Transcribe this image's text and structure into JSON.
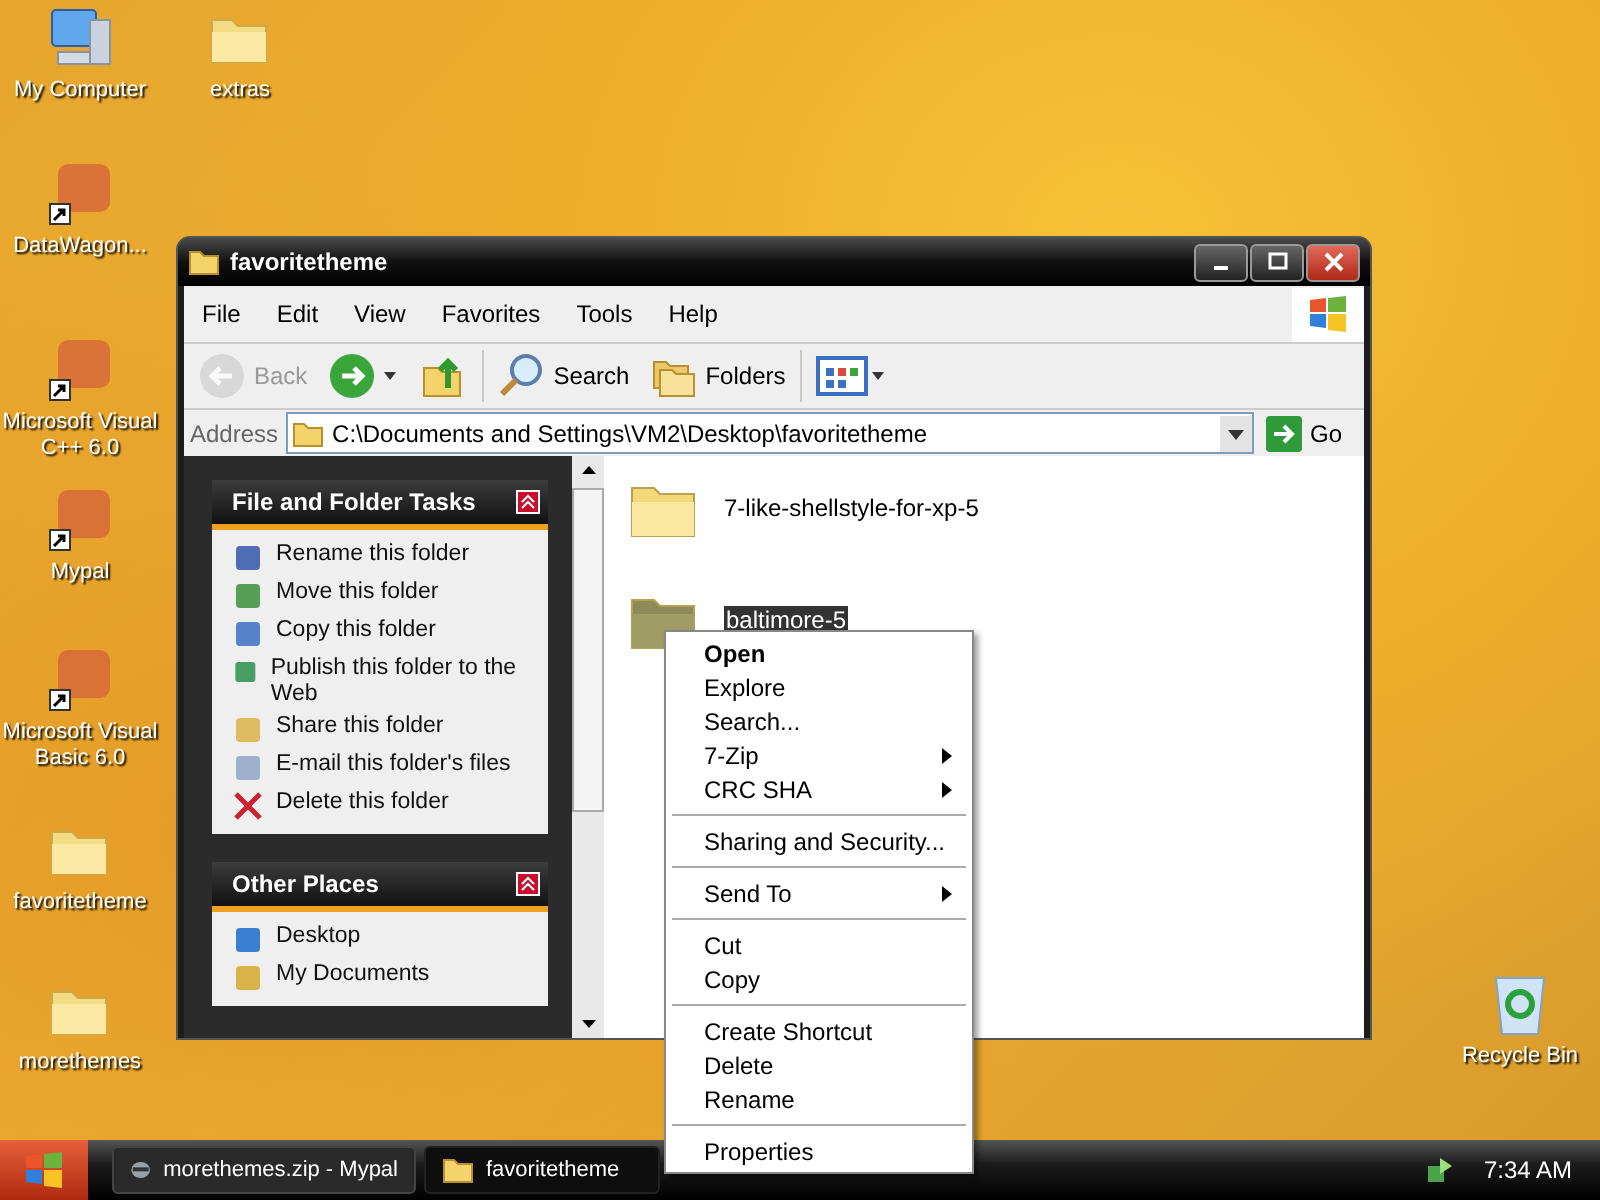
{
  "desktop_icons": [
    {
      "label": "My Computer",
      "kind": "computer"
    },
    {
      "label": "extras",
      "kind": "folder"
    },
    {
      "label": "DataWagon...",
      "kind": "shortcut"
    },
    {
      "label": "Microsoft Visual C++ 6.0",
      "kind": "shortcut"
    },
    {
      "label": "Mypal",
      "kind": "shortcut"
    },
    {
      "label": "Microsoft Visual Basic 6.0",
      "kind": "shortcut"
    },
    {
      "label": "favoritetheme",
      "kind": "folder"
    },
    {
      "label": "morethemes",
      "kind": "folder"
    },
    {
      "label": "Recycle Bin",
      "kind": "recycle"
    }
  ],
  "window": {
    "title": "favoritetheme",
    "menu": [
      "File",
      "Edit",
      "View",
      "Favorites",
      "Tools",
      "Help"
    ],
    "toolbar": [
      {
        "label": "Back",
        "kind": "back",
        "disabled": true
      },
      {
        "kind": "forward",
        "disabled": false
      },
      {
        "kind": "up",
        "disabled": false
      },
      {
        "label": "Search",
        "kind": "search",
        "disabled": false
      },
      {
        "label": "Folders",
        "kind": "folders",
        "disabled": false
      },
      {
        "kind": "views",
        "disabled": false
      }
    ],
    "address": {
      "label": "Address",
      "value": "C:\\Documents and Settings\\VM2\\Desktop\\favoritetheme",
      "go": "Go"
    },
    "panels": [
      {
        "title": "File and Folder Tasks",
        "items": [
          "Rename this folder",
          "Move this folder",
          "Copy this folder",
          "Publish this folder to the Web",
          "Share this folder",
          "E-mail this folder's files",
          "Delete this folder"
        ]
      },
      {
        "title": "Other Places",
        "items": [
          "Desktop",
          "My Documents"
        ]
      }
    ],
    "files": [
      {
        "name": "7-like-shellstyle-for-xp-5",
        "selected": false
      },
      {
        "name": "baltimore-5",
        "selected": true
      }
    ]
  },
  "context_menu": [
    [
      {
        "label": "Open",
        "default": true,
        "submenu": false
      },
      {
        "label": "Explore",
        "default": false,
        "submenu": false
      },
      {
        "label": "Search...",
        "default": false,
        "submenu": false
      },
      {
        "label": "7-Zip",
        "default": false,
        "submenu": true
      },
      {
        "label": "CRC SHA",
        "default": false,
        "submenu": true
      }
    ],
    [
      {
        "label": "Sharing and Security...",
        "default": false,
        "submenu": false
      }
    ],
    [
      {
        "label": "Send To",
        "default": false,
        "submenu": true
      }
    ],
    [
      {
        "label": "Cut",
        "default": false,
        "submenu": false
      },
      {
        "label": "Copy",
        "default": false,
        "submenu": false
      }
    ],
    [
      {
        "label": "Create Shortcut",
        "default": false,
        "submenu": false
      },
      {
        "label": "Delete",
        "default": false,
        "submenu": false
      },
      {
        "label": "Rename",
        "default": false,
        "submenu": false
      }
    ],
    [
      {
        "label": "Properties",
        "default": false,
        "submenu": false
      }
    ]
  ],
  "taskbar": {
    "tasks": [
      {
        "label": "morethemes.zip - Mypal",
        "kind": "browser",
        "selected": false
      },
      {
        "label": "favoritetheme",
        "kind": "folder",
        "selected": true
      }
    ],
    "clock": "7:34 AM"
  }
}
